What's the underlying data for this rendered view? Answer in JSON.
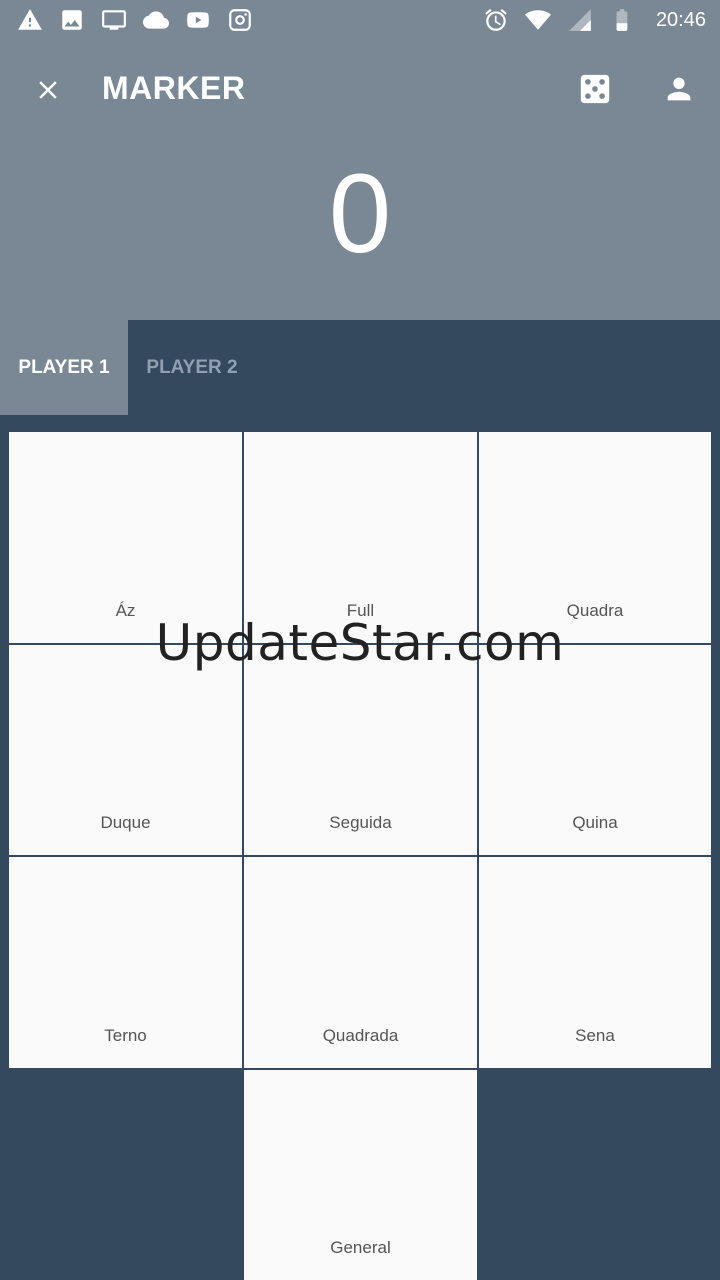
{
  "status_bar": {
    "time": "20:46",
    "left_icons": [
      "warning-icon",
      "image-icon",
      "cast-icon",
      "cloud-icon",
      "youtube-icon",
      "instagram-icon"
    ],
    "right_icons": [
      "alarm-icon",
      "wifi-icon",
      "signal-icon",
      "battery-icon"
    ]
  },
  "header": {
    "title": "MARKER",
    "score": "0"
  },
  "tabs": [
    {
      "label": "PLAYER 1",
      "active": true
    },
    {
      "label": "PLAYER 2",
      "active": false
    }
  ],
  "grid": {
    "cells": [
      {
        "label": "Áz"
      },
      {
        "label": "Full"
      },
      {
        "label": "Quadra"
      },
      {
        "label": "Duque"
      },
      {
        "label": "Seguida"
      },
      {
        "label": "Quina"
      },
      {
        "label": "Terno"
      },
      {
        "label": "Quadrada"
      },
      {
        "label": "Sena"
      },
      {
        "label": "General"
      }
    ]
  },
  "watermark": "UpdateStar.com",
  "colors": {
    "header_bg": "#7a8896",
    "body_bg": "#34495e",
    "cell_bg": "#fafafa",
    "inactive_tab_text": "#8fa0b2"
  }
}
